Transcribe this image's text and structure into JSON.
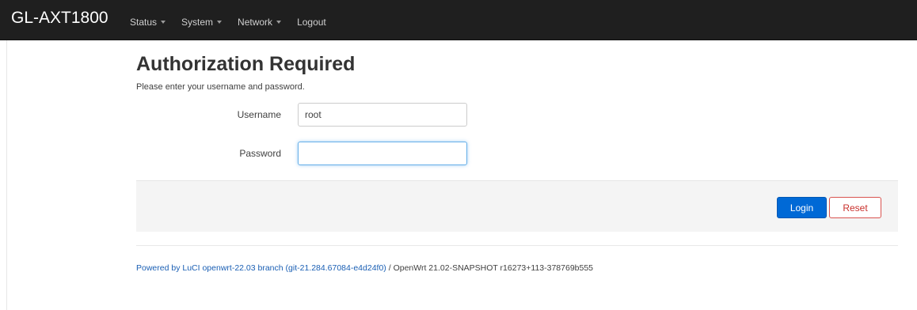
{
  "header": {
    "brand": "GL-AXT1800",
    "menu": [
      {
        "label": "Status",
        "dropdown": true
      },
      {
        "label": "System",
        "dropdown": true
      },
      {
        "label": "Network",
        "dropdown": true
      },
      {
        "label": "Logout",
        "dropdown": false
      }
    ]
  },
  "auth": {
    "title": "Authorization Required",
    "subtitle": "Please enter your username and password.",
    "username_label": "Username",
    "username_value": "root",
    "password_label": "Password",
    "password_value": ""
  },
  "actions": {
    "login_label": "Login",
    "reset_label": "Reset"
  },
  "footer": {
    "link_text": "Powered by LuCI openwrt-22.03 branch (git-21.284.67084-e4d24f0)",
    "separator": " / ",
    "version_text": "OpenWrt 21.02-SNAPSHOT r16273+113-378769b555"
  },
  "colors": {
    "navbar_bg": "#1f1f1f",
    "primary_button": "#0069d6",
    "reset_border": "#d9534f",
    "link": "#1a5fb4"
  }
}
